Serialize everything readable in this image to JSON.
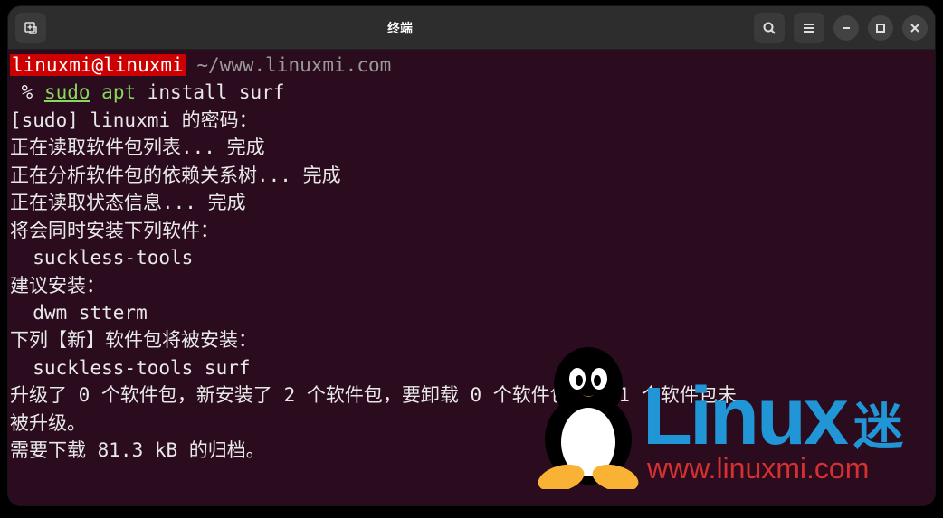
{
  "window": {
    "title": "终端"
  },
  "prompt": {
    "userhost": "linuxmi@linuxmi",
    "path": "~/www.linuxmi.com",
    "symbol": " % ",
    "cmd_sudo": "sudo",
    "cmd_apt": "apt",
    "cmd_rest": "install surf"
  },
  "output": {
    "l1": "[sudo] linuxmi 的密码：",
    "l2": "正在读取软件包列表... 完成",
    "l3": "正在分析软件包的依赖关系树... 完成",
    "l4": "正在读取状态信息... 完成",
    "l5": "将会同时安装下列软件：",
    "l6": "  suckless-tools",
    "l7": "建议安装：",
    "l8": "  dwm stterm",
    "l9": "下列【新】软件包将被安装：",
    "l10": "  suckless-tools surf",
    "l11": "升级了 0 个软件包，新安装了 2 个软件包，要卸载 0 个软件包，有 1 个软件包未",
    "l12": "被升级。",
    "l13": "需要下载 81.3 kB 的归档。"
  },
  "watermark": {
    "brand": "Linux",
    "suffix": "迷",
    "url": "www.linuxmi.com"
  }
}
